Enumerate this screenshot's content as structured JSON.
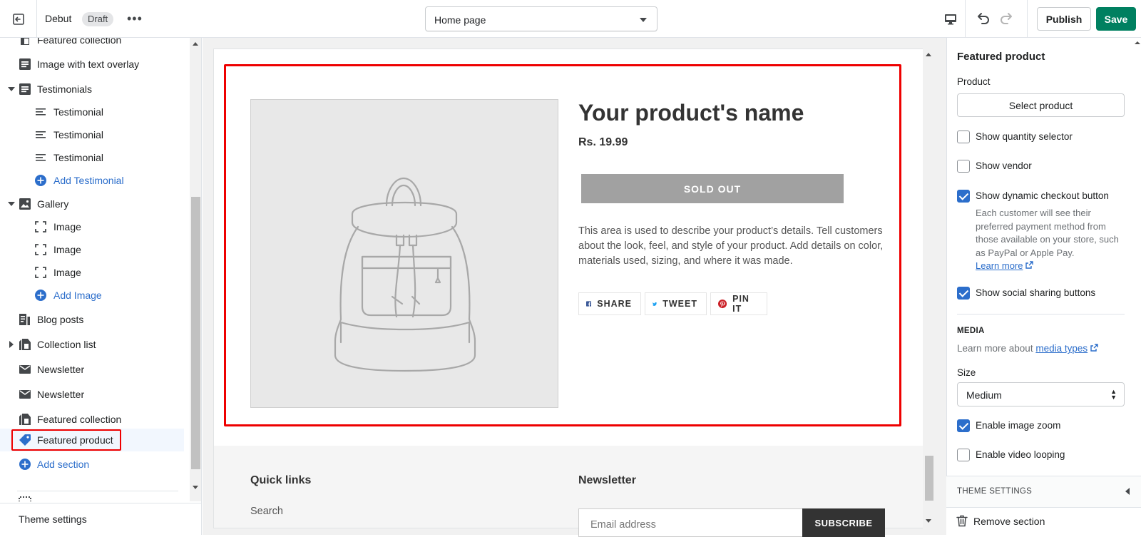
{
  "topbar": {
    "theme_name": "Debut",
    "status_badge": "Draft",
    "more": "•••",
    "page_select": "Home page",
    "publish_label": "Publish",
    "save_label": "Save"
  },
  "sidebar": {
    "items": [
      {
        "label": "Featured collection"
      },
      {
        "label": "Image with text overlay"
      },
      {
        "label": "Testimonials"
      },
      {
        "label": "Testimonial"
      },
      {
        "label": "Testimonial"
      },
      {
        "label": "Testimonial"
      },
      {
        "label": "Add Testimonial"
      },
      {
        "label": "Gallery"
      },
      {
        "label": "Image"
      },
      {
        "label": "Image"
      },
      {
        "label": "Image"
      },
      {
        "label": "Add Image"
      },
      {
        "label": "Blog posts"
      },
      {
        "label": "Collection list"
      },
      {
        "label": "Newsletter"
      },
      {
        "label": "Newsletter"
      },
      {
        "label": "Featured collection"
      },
      {
        "label": "Featured product"
      },
      {
        "label": "Add section"
      }
    ],
    "footer_label": "Theme settings"
  },
  "preview": {
    "product_name": "Your product's name",
    "price": "Rs. 19.99",
    "sold_out": "SOLD OUT",
    "description": "This area is used to describe your product’s details. Tell customers about the look, feel, and style of your product. Add details on color, materials used, sizing, and where it was made.",
    "share": [
      "SHARE",
      "TWEET",
      "PIN IT"
    ],
    "footer": {
      "quick_links_heading": "Quick links",
      "quick_link_1": "Search",
      "newsletter_heading": "Newsletter",
      "email_placeholder": "Email address",
      "subscribe_label": "SUBSCRIBE"
    }
  },
  "settings": {
    "title": "Featured product",
    "product_label": "Product",
    "select_product": "Select product",
    "checkboxes": [
      {
        "label": "Show quantity selector",
        "checked": false
      },
      {
        "label": "Show vendor",
        "checked": false
      },
      {
        "label": "Show dynamic checkout button",
        "checked": true
      },
      {
        "label": "Show social sharing buttons",
        "checked": true
      },
      {
        "label": "Enable image zoom",
        "checked": true
      },
      {
        "label": "Enable video looping",
        "checked": false
      }
    ],
    "dynamic_help": "Each customer will see their preferred payment method from those available on your store, such as PayPal or Apple Pay.",
    "learn_more": "Learn more",
    "media_heading": "MEDIA",
    "media_learn_prefix": "Learn more about",
    "media_types_link": "media types",
    "size_label": "Size",
    "size_value": "Medium",
    "theme_settings": "THEME SETTINGS",
    "remove_section": "Remove section"
  },
  "colors": {
    "accent": "#2c6ecb",
    "save_green": "#008060",
    "highlight_red": "#e00000",
    "sold_out_gray": "#a1a1a1"
  }
}
